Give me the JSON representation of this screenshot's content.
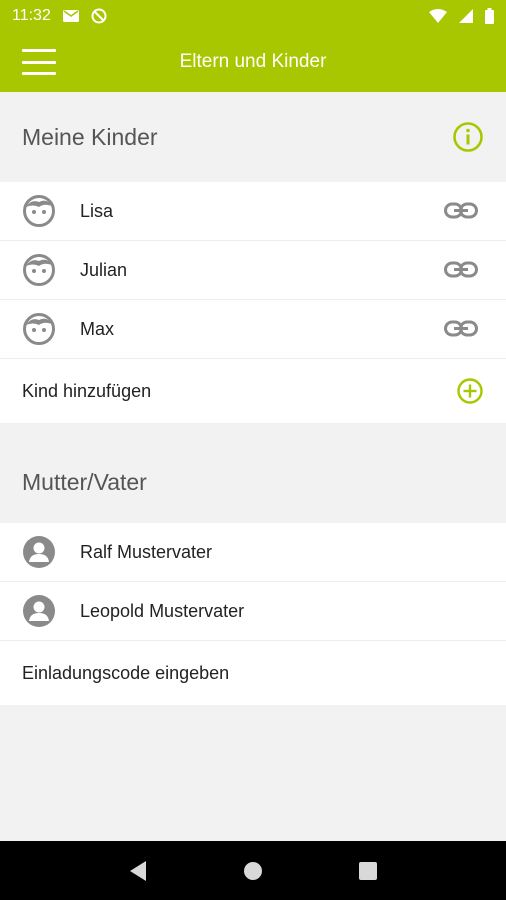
{
  "status_bar": {
    "time": "11:32",
    "icons": [
      "mail-icon",
      "sync-off-icon",
      "wifi-icon",
      "signal-icon",
      "battery-icon"
    ]
  },
  "app_bar": {
    "title": "Eltern und Kinder",
    "menu_icon": "hamburger-menu-icon"
  },
  "children_section": {
    "title": "Meine Kinder",
    "info_icon": "info-icon",
    "children": [
      {
        "name": "Lisa"
      },
      {
        "name": "Julian"
      },
      {
        "name": "Max"
      }
    ],
    "add_label": "Kind hinzufügen"
  },
  "parents_section": {
    "title": "Mutter/Vater",
    "parents": [
      {
        "name": "Ralf Mustervater"
      },
      {
        "name": "Leopold Mustervater"
      }
    ],
    "invite_label": "Einladungscode eingeben"
  },
  "colors": {
    "accent": "#a9c700",
    "icon_gray": "#8a8a8a",
    "background": "#f2f2f2"
  }
}
